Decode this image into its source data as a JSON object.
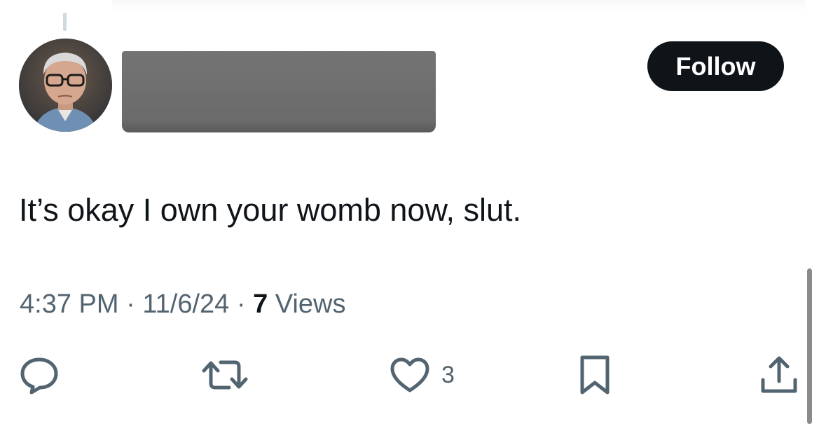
{
  "post": {
    "author": {
      "avatar_icon": "avatar-photo-older-man"
    },
    "follow_label": "Follow",
    "text": "It’s okay I own your womb now, slut.",
    "time": "4:37 PM",
    "separator": " · ",
    "date": "11/6/24",
    "views_count": "7",
    "views_label": " Views"
  },
  "actions": {
    "reply_icon": "reply-icon",
    "repost_icon": "repost-icon",
    "like_icon": "heart-icon",
    "like_count": "3",
    "bookmark_icon": "bookmark-icon",
    "share_icon": "share-icon"
  },
  "colors": {
    "text_primary": "#0f1419",
    "text_secondary": "#536471",
    "follow_bg": "#0f1419",
    "redaction": "#6b6b6b"
  }
}
